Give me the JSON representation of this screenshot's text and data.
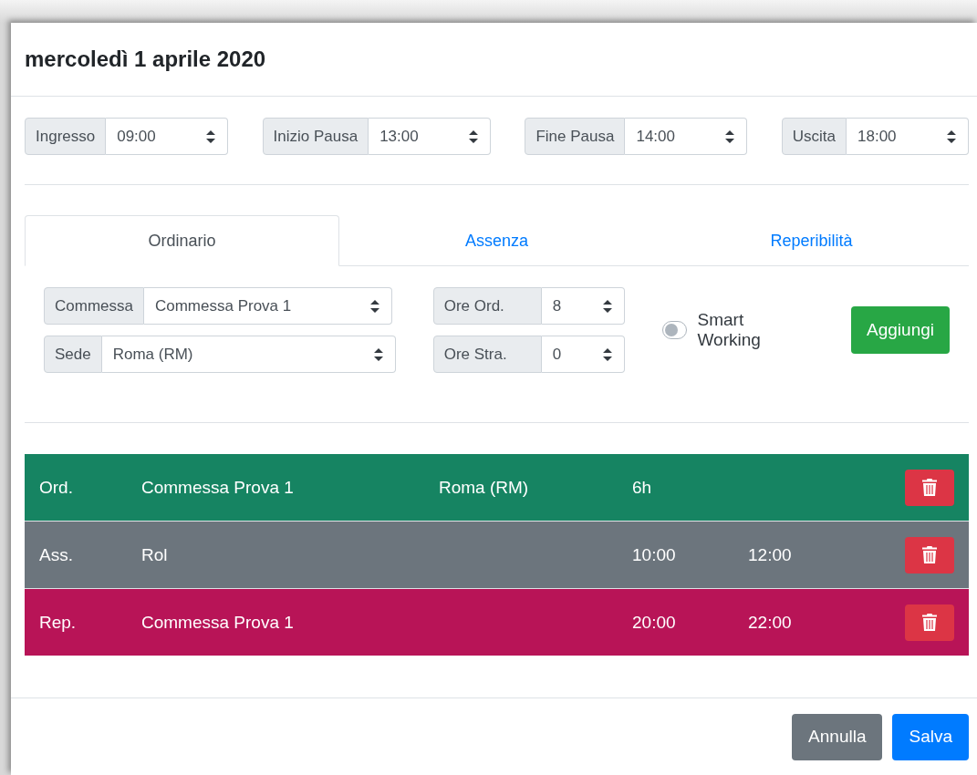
{
  "dialog": {
    "title": "mercoledì 1 aprile 2020"
  },
  "times": [
    {
      "label": "Ingresso",
      "value": "09:00"
    },
    {
      "label": "Inizio Pausa",
      "value": "13:00"
    },
    {
      "label": "Fine Pausa",
      "value": "14:00"
    },
    {
      "label": "Uscita",
      "value": "18:00"
    }
  ],
  "tabs": [
    {
      "label": "Ordinario",
      "selected": true
    },
    {
      "label": "Assenza",
      "selected": false
    },
    {
      "label": "Reperibilità",
      "selected": false
    }
  ],
  "form": {
    "commessa": {
      "label": "Commessa",
      "value": "Commessa Prova 1"
    },
    "sede": {
      "label": "Sede",
      "value": "Roma (RM)"
    },
    "ore_ord": {
      "label": "Ore Ord.",
      "value": "8"
    },
    "ore_stra": {
      "label": "Ore Stra.",
      "value": "0"
    },
    "smart_working": {
      "label": "Smart Working",
      "on": false
    },
    "add_button": "Aggiungi"
  },
  "entries": [
    {
      "type": "Ord.",
      "project": "Commessa Prova 1",
      "place": "Roma (RM)",
      "hours": "6h",
      "color": "#168462"
    },
    {
      "type": "Ass.",
      "project": "Rol",
      "start": "10:00",
      "end": "12:00",
      "color": "#6c757d"
    },
    {
      "type": "Rep.",
      "project": "Commessa Prova 1",
      "start": "20:00",
      "end": "22:00",
      "color": "#b81457"
    }
  ],
  "buttons": [
    {
      "label": "Annulla",
      "kind": "secondary"
    },
    {
      "label": "Salva",
      "kind": "primary"
    }
  ]
}
